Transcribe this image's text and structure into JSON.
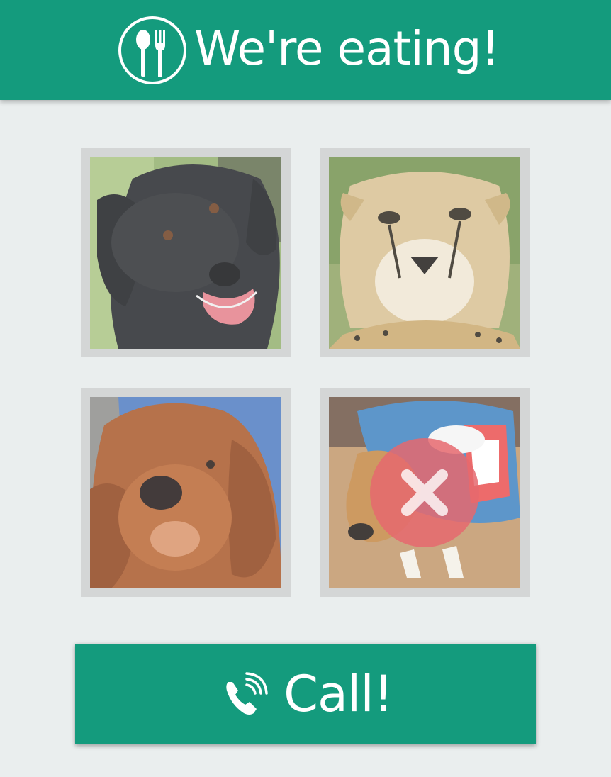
{
  "header": {
    "title": "We're eating!",
    "icon": "spoon-fork-icon"
  },
  "participants": [
    {
      "icon": "black-labrador-photo"
    },
    {
      "icon": "cheetah-photo"
    },
    {
      "icon": "cocker-spaniel-photo"
    },
    {
      "icon": "dachshund-costume-photo",
      "declined": true,
      "status_icon": "decline-x-icon"
    }
  ],
  "call_button": {
    "label": "Call!",
    "icon": "phone-icon"
  },
  "colors": {
    "primary": "#149b7d",
    "background": "#eaeeee",
    "tile_frame": "#d4d6d6",
    "decline": "#e0484f"
  }
}
